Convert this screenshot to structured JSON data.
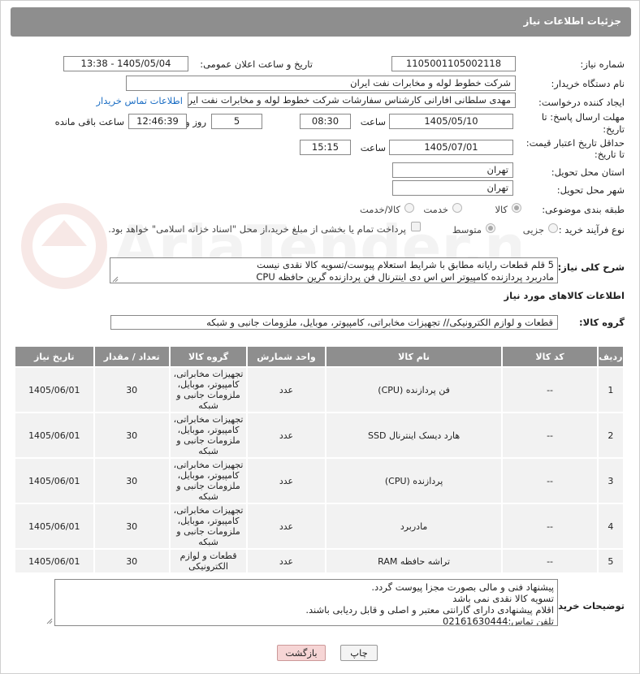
{
  "header": {
    "title": "جزئیات اطلاعات نیاز"
  },
  "watermark_text": "AriaTender.net",
  "fields": {
    "need_number_label": "شماره نیاز:",
    "need_number": "1105001105002118",
    "announce_label": "تاریخ و ساعت اعلان عمومی:",
    "announce_value": "1405/05/04 - 13:38",
    "buyer_org_label": "نام دستگاه خریدار:",
    "buyer_org": "شرکت خطوط لوله و مخابرات نفت ایران",
    "creator_label": "ایجاد کننده درخواست:",
    "creator": "مهدی سلطانی افارانی کارشناس سفارشات  شرکت خطوط لوله و مخابرات نفت ایران",
    "contact_link": "اطلاعات تماس خریدار",
    "send_deadline_label_1": "مهلت ارسال پاسخ: تا",
    "send_deadline_label_2": "تاریخ:",
    "send_date": "1405/05/10",
    "time_label": "ساعت",
    "send_time": "08:30",
    "days_value": "5",
    "days_label": "روز و",
    "remaining_time": "12:46:39",
    "remaining_label": "ساعت باقی مانده",
    "price_deadline_label_1": "حداقل تاریخ اعتبار قیمت:",
    "price_deadline_label_2": "تا تاریخ:",
    "price_date": "1405/07/01",
    "price_time": "15:15",
    "province_label": "استان محل تحویل:",
    "province": "تهران",
    "city_label": "شهر محل تحویل:",
    "city": "تهران",
    "category_label": "طبقه بندی موضوعی:",
    "category_options": [
      "کالا",
      "خدمت",
      "کالا/خدمت"
    ],
    "process_label": "نوع فرآیند خرید :",
    "process_options": [
      "جزیی",
      "متوسط"
    ],
    "payment_text": "پرداخت تمام یا بخشی از مبلغ خرید،از محل \"اسناد خزانه اسلامی\" خواهد بود."
  },
  "description": {
    "label": "شرح کلی نیاز:",
    "lines": [
      "5 قلم قطعات رایانه مطابق با شرایط استعلام پیوست/تسویه کالا نقدی نیست",
      "مادربرد  پردازنده کامپیوتر  اس اس دی اینترنال فن پردازنده گرین حافظه  CPU"
    ]
  },
  "goods_info_title": "اطلاعات کالاهای مورد نیاز",
  "goods_group": {
    "label": "گروه کالا:",
    "value": "قطعات و لوازم الکترونیکی// تجهیزات مخابراتی، کامپیوتر، موبایل، ملزومات جانبی و شبکه"
  },
  "table": {
    "headers": [
      "ردیف",
      "کد کالا",
      "نام کالا",
      "واحد شمارش",
      "گروه کالا",
      "تعداد / مقدار",
      "تاریخ نیاز"
    ],
    "rows": [
      {
        "idx": "1",
        "code": "--",
        "name": "فن پردازنده (CPU)",
        "unit": "عدد",
        "group": "تجهیزات مخابراتی، کامپیوتر، موبایل، ملزومات جانبی و شبکه",
        "qty": "30",
        "date": "1405/06/01"
      },
      {
        "idx": "2",
        "code": "--",
        "name": "هارد دیسک اینترنال SSD",
        "unit": "عدد",
        "group": "تجهیزات مخابراتی، کامپیوتر، موبایل، ملزومات جانبی و شبکه",
        "qty": "30",
        "date": "1405/06/01"
      },
      {
        "idx": "3",
        "code": "--",
        "name": "پردازنده (CPU)",
        "unit": "عدد",
        "group": "تجهیزات مخابراتی، کامپیوتر، موبایل، ملزومات جانبی و شبکه",
        "qty": "30",
        "date": "1405/06/01"
      },
      {
        "idx": "4",
        "code": "--",
        "name": "مادربرد",
        "unit": "عدد",
        "group": "تجهیزات مخابراتی، کامپیوتر، موبایل، ملزومات جانبی و شبکه",
        "qty": "30",
        "date": "1405/06/01"
      },
      {
        "idx": "5",
        "code": "--",
        "name": "تراشه حافظه RAM",
        "unit": "عدد",
        "group": "قطعات و لوازم الکترونیکی",
        "qty": "30",
        "date": "1405/06/01"
      }
    ]
  },
  "buyer_notes": {
    "label": "توضیحات خریدار:",
    "lines": [
      "پیشنهاد فنی و مالی بصورت مجزا پیوست گردد.",
      "تسویه کالا نقدی نمی باشد",
      "اقلام پیشنهادی  دارای گارانتی معتبر و اصلی و قابل ردیابی باشند.",
      "تلفن تماس:02161630444"
    ]
  },
  "buttons": {
    "print": "چاپ",
    "back": "بازگشت"
  }
}
